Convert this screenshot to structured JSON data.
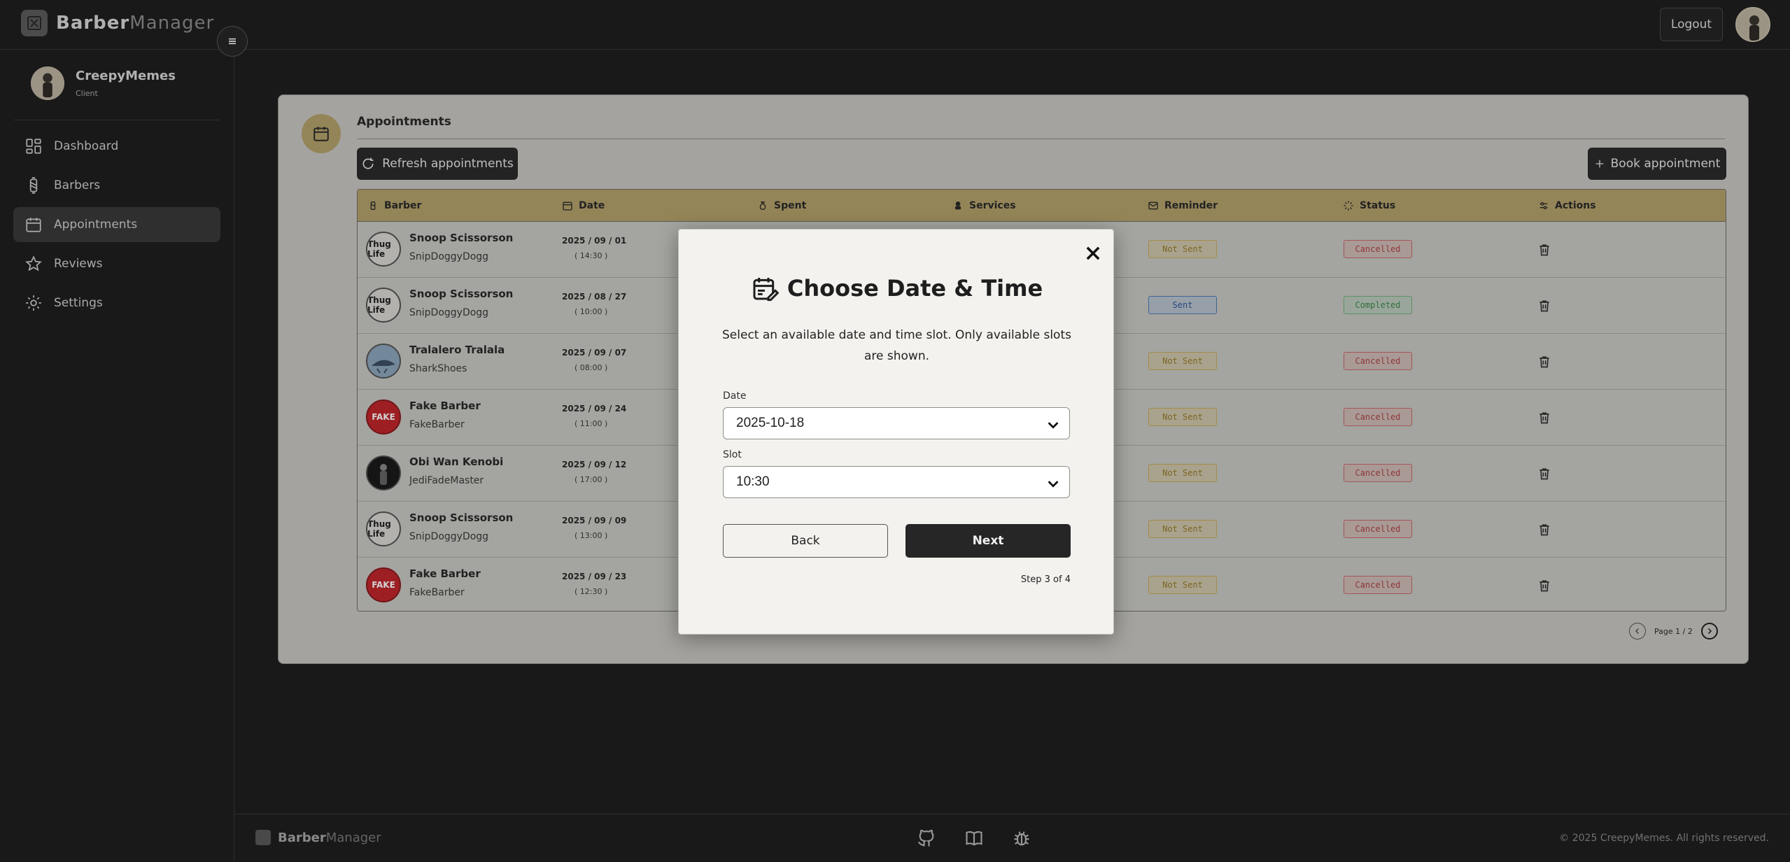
{
  "brand": {
    "bold": "Barber",
    "light": "Manager"
  },
  "header": {
    "logout_label": "Logout"
  },
  "profile": {
    "name": "CreepyMemes",
    "role": "Client"
  },
  "sidebar": {
    "items": [
      {
        "label": "Dashboard",
        "icon": "dashboard-icon"
      },
      {
        "label": "Barbers",
        "icon": "barber-pole-icon"
      },
      {
        "label": "Appointments",
        "icon": "calendar-icon",
        "active": true
      },
      {
        "label": "Reviews",
        "icon": "star-icon"
      },
      {
        "label": "Settings",
        "icon": "gear-icon"
      }
    ]
  },
  "card": {
    "title": "Appointments",
    "refresh_label": "Refresh appointments",
    "book_label": "Book appointment"
  },
  "table": {
    "headers": [
      "Barber",
      "Date",
      "Spent",
      "Services",
      "Reminder",
      "Status",
      "Actions"
    ],
    "rows": [
      {
        "avatar": "Thug Life",
        "name": "Snoop Scissorson",
        "user": "SnipDoggyDogg",
        "date": "2025 / 09 / 01",
        "time": "( 14:30 )",
        "reminder": "Not Sent",
        "status": "Cancelled"
      },
      {
        "avatar": "Thug Life",
        "name": "Snoop Scissorson",
        "user": "SnipDoggyDogg",
        "date": "2025 / 08 / 27",
        "time": "( 10:00 )",
        "reminder": "Sent",
        "status": "Completed"
      },
      {
        "avatar": "",
        "name": "Tralalero Tralala",
        "user": "SharkShoes",
        "date": "2025 / 09 / 07",
        "time": "( 08:00 )",
        "reminder": "Not Sent",
        "status": "Cancelled"
      },
      {
        "avatar": "FAKE",
        "name": "Fake Barber",
        "user": "FakeBarber",
        "date": "2025 / 09 / 24",
        "time": "( 11:00 )",
        "reminder": "Not Sent",
        "status": "Cancelled"
      },
      {
        "avatar": "",
        "name": "Obi Wan Kenobi",
        "user": "JediFadeMaster",
        "date": "2025 / 09 / 12",
        "time": "( 17:00 )",
        "reminder": "Not Sent",
        "status": "Cancelled"
      },
      {
        "avatar": "Thug Life",
        "name": "Snoop Scissorson",
        "user": "SnipDoggyDogg",
        "date": "2025 / 09 / 09",
        "time": "( 13:00 )",
        "reminder": "Not Sent",
        "status": "Cancelled"
      },
      {
        "avatar": "FAKE",
        "name": "Fake Barber",
        "user": "FakeBarber",
        "date": "2025 / 09 / 23",
        "time": "( 12:30 )",
        "reminder": "Not Sent",
        "status": "Cancelled"
      }
    ]
  },
  "pager": {
    "label": "Page 1 / 2"
  },
  "modal": {
    "title": "Choose Date & Time",
    "description": "Select an available date and time slot. Only available slots are shown.",
    "date_label": "Date",
    "date_value": "2025-10-18",
    "slot_label": "Slot",
    "slot_value": "10:30",
    "back_label": "Back",
    "next_label": "Next",
    "step": "Step 3 of 4"
  },
  "footer": {
    "brand_bold": "Barber",
    "brand_light": "Manager",
    "copyright": "© 2025 CreepyMemes. All rights reserved."
  },
  "colors": {
    "accent": "#b5a36c",
    "dark": "#1f1f1f",
    "card": "#c8c7c3"
  }
}
